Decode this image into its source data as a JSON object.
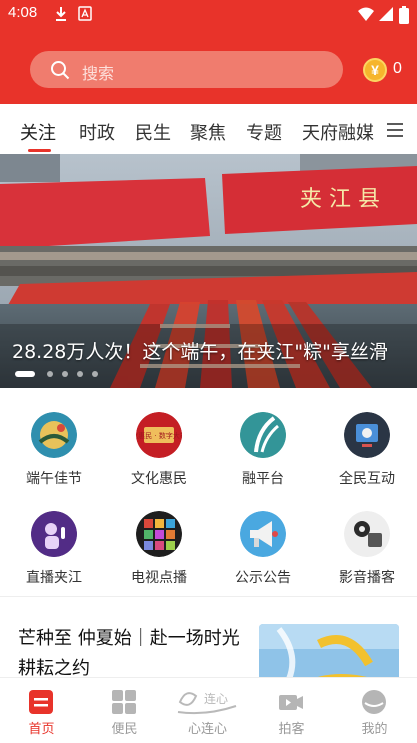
{
  "status_bar": {
    "time": "4:08"
  },
  "header": {
    "search_placeholder": "搜索",
    "coin_symbol": "¥",
    "coin_count": "0"
  },
  "tabs": [
    {
      "label": "关注",
      "active": true
    },
    {
      "label": "时政"
    },
    {
      "label": "民生"
    },
    {
      "label": "聚焦"
    },
    {
      "label": "专题"
    },
    {
      "label": "天府融媒"
    }
  ],
  "banner": {
    "caption": "28.28万人次！这个端午，在夹江\"粽\"享丝滑",
    "sign_text": "夹 江 县",
    "slide_count": 5,
    "active_slide": 0
  },
  "grid": [
    {
      "label": "端午佳节",
      "icon": "dragon-boat-icon"
    },
    {
      "label": "文化惠民",
      "icon": "culture-gift-icon",
      "badge": "文化惠民 · 数字大礼包"
    },
    {
      "label": "融平台",
      "icon": "leaf-platform-icon"
    },
    {
      "label": "全民互动",
      "icon": "interaction-icon"
    },
    {
      "label": "直播夹江",
      "icon": "live-broadcast-icon"
    },
    {
      "label": "电视点播",
      "icon": "tv-on-demand-icon"
    },
    {
      "label": "公示公告",
      "icon": "megaphone-icon"
    },
    {
      "label": "影音播客",
      "icon": "podcast-icon"
    }
  ],
  "news": {
    "title": "芒种至 仲夏始｜赴一场时光耕耘之约"
  },
  "bottom_nav": [
    {
      "label": "首页",
      "icon": "home-icon",
      "active": true
    },
    {
      "label": "便民",
      "icon": "services-grid-icon"
    },
    {
      "label": "心连心",
      "icon": "heart-link-icon",
      "logo_text": "连心"
    },
    {
      "label": "拍客",
      "icon": "video-camera-icon"
    },
    {
      "label": "我的",
      "icon": "profile-icon"
    }
  ],
  "colors": {
    "brand_red": "#e8332a",
    "coin_gold": "#f6b52c"
  }
}
